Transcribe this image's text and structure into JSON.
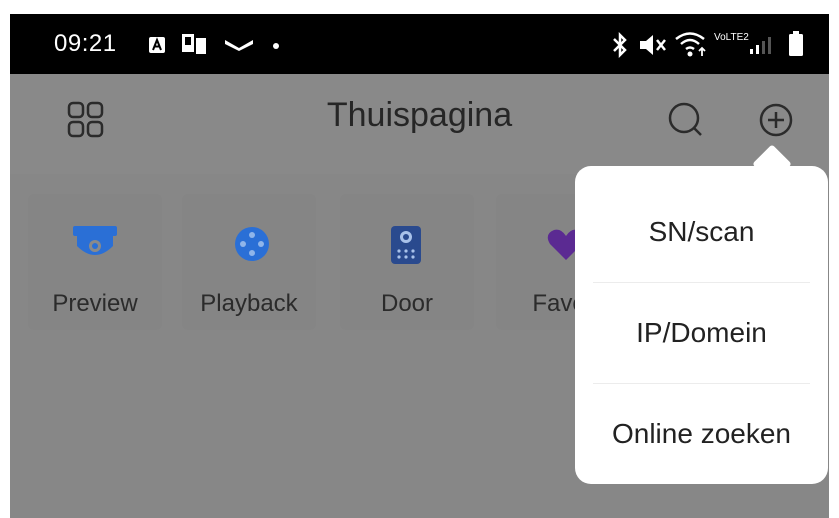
{
  "status_bar": {
    "time": "09:21",
    "network_label": "VoLTE2"
  },
  "header": {
    "title": "Thuispagina",
    "icons": [
      "grid-icon",
      "search-icon",
      "add-circle-icon"
    ]
  },
  "quick_access": [
    {
      "label": "Preview",
      "icon": "camera-icon"
    },
    {
      "label": "Playback",
      "icon": "playback-icon"
    },
    {
      "label": "Door",
      "icon": "doorbell-icon"
    },
    {
      "label": "Favor",
      "icon": "heart-icon"
    }
  ],
  "add_menu": {
    "items": [
      "SN/scan",
      "IP/Domein",
      "Online zoeken"
    ]
  },
  "colors": {
    "accent_blue": "#2a6fd6",
    "favorite_purple": "#5b2a92",
    "overlay_gray": "#8a8a8a",
    "status_bar": "#000000"
  }
}
